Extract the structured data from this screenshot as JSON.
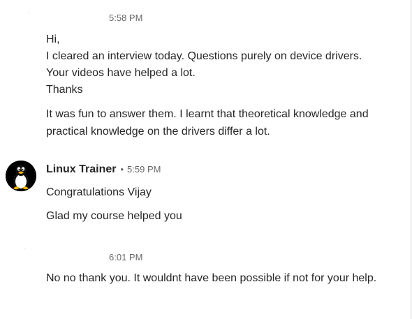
{
  "messages": {
    "group1": {
      "time": "5:58 PM",
      "lines": [
        "Hi,",
        "I cleared an interview today. Questions purely on device drivers.",
        "Your videos have helped a lot.",
        "Thanks"
      ],
      "followup": "It was fun to answer them. I learnt that theoretical knowledge and practical knowledge on the drivers differ a lot."
    },
    "group2": {
      "sender": "Linux Trainer",
      "separator": "•",
      "time": "5:59 PM",
      "line1": "Congratulations Vijay",
      "line2": "Glad my course helped you"
    },
    "group3": {
      "time": "6:01 PM",
      "text": "No no thank you. It wouldnt have been possible if not for your help."
    }
  },
  "icons": {
    "avatar": "tux-penguin-avatar-icon"
  },
  "colors": {
    "text": "#262626",
    "muted": "#666666",
    "avatar_bg": "#000000"
  }
}
